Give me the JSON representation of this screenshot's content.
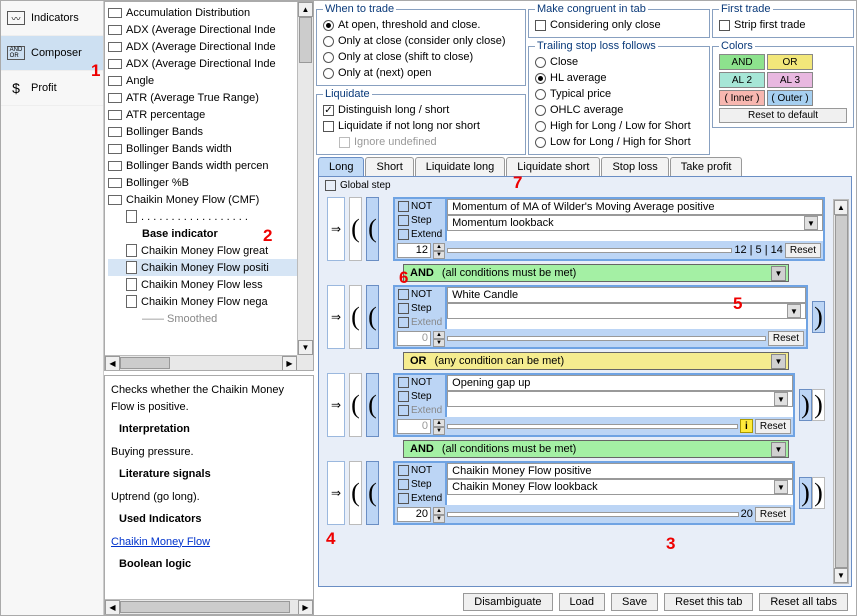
{
  "left_nav": {
    "indicators": "Indicators",
    "composer": "Composer",
    "profit": "Profit"
  },
  "tree": {
    "items": [
      "Accumulation Distribution",
      "ADX (Average Directional Inde",
      "ADX (Average Directional Inde",
      "ADX (Average Directional Inde",
      "Angle",
      "ATR (Average True Range)",
      "ATR percentage",
      "Bollinger Bands",
      "Bollinger Bands width",
      "Bollinger Bands width percen",
      "Bollinger %B",
      "Chaikin Money Flow (CMF)"
    ],
    "cmf_children": {
      "separator": ". . . . . . . . . . . . . . . . . .",
      "base": "Base indicator",
      "items": [
        "Chaikin Money Flow great",
        "Chaikin Money Flow positi",
        "Chaikin Money Flow less",
        "Chaikin Money Flow nega"
      ],
      "smoothed": "—— Smoothed"
    }
  },
  "info": {
    "p1": "Checks whether the Chaikin Money Flow is positive.",
    "h1": "Interpretation",
    "p2": "Buying pressure.",
    "h2": "Literature signals",
    "p3": "Uptrend (go long).",
    "h3": "Used Indicators",
    "link": "Chaikin Money Flow",
    "h4": "Boolean logic"
  },
  "opts": {
    "when_title": "When to trade",
    "when": [
      "At open, threshold and close.",
      "Only at close (consider only close)",
      "Only at close (shift to close)",
      "Only at (next) open"
    ],
    "liq_title": "Liquidate",
    "liq1": "Distinguish long / short",
    "liq2": "Liquidate if not long nor short",
    "liq3": "Ignore undefined",
    "cong_title": "Make congruent in tab",
    "cong1": "Considering only close",
    "trail_title": "Trailing stop loss follows",
    "trail": [
      "Close",
      "HL average",
      "Typical price",
      "OHLC average",
      "High for Long / Low for Short",
      "Low for Long / High for Short"
    ],
    "first_title": "First trade",
    "first1": "Strip first trade",
    "colors_title": "Colors",
    "colors": {
      "and": "AND",
      "or": "OR",
      "al2": "AL 2",
      "al3": "AL 3",
      "inner": "( Inner )",
      "outer": "( Outer )"
    },
    "reset_default": "Reset to default"
  },
  "tabs": [
    "Long",
    "Short",
    "Liquidate long",
    "Liquidate short",
    "Stop loss",
    "Take profit"
  ],
  "global_step": "Global step",
  "rules": [
    {
      "not": "NOT",
      "step": "Step",
      "extend": "Extend",
      "text": "Momentum of MA of Wilder's Moving Average positive",
      "sel": "Momentum lookback",
      "n1": "12",
      "tail": "12 | 5 | 14",
      "reset": "Reset"
    },
    {
      "not": "NOT",
      "step": "Step",
      "extend": "Extend",
      "text": "White Candle",
      "sel": "",
      "n1": "0",
      "tail": "",
      "reset": "Reset"
    },
    {
      "not": "NOT",
      "step": "Step",
      "extend": "Extend",
      "text": "Opening gap up",
      "sel": "",
      "n1": "0",
      "tail": "",
      "reset": "Reset",
      "info": "i"
    },
    {
      "not": "NOT",
      "step": "Step",
      "extend": "Extend",
      "text": "Chaikin Money Flow positive",
      "sel": "Chaikin Money Flow lookback",
      "n1": "20",
      "tail": "20",
      "reset": "Reset"
    }
  ],
  "logic": {
    "and": "AND",
    "and_desc": "(all conditions must be met)",
    "or": "OR",
    "or_desc": "(any condition can be met)"
  },
  "bottom": {
    "disamb": "Disambiguate",
    "load": "Load",
    "save": "Save",
    "reset_tab": "Reset this tab",
    "reset_all": "Reset all tabs"
  },
  "ann": {
    "1": "1",
    "2": "2",
    "3": "3",
    "4": "4",
    "5": "5",
    "6": "6",
    "7": "7"
  }
}
